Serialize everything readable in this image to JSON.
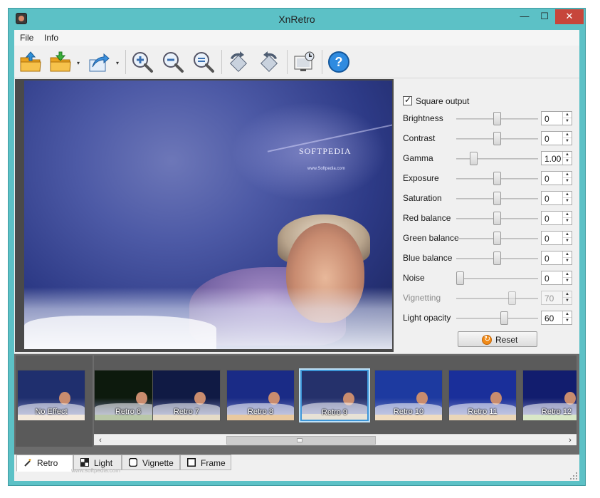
{
  "window": {
    "title": "XnRetro",
    "accent": "#5cc1c6",
    "close_color": "#c7463b",
    "min_symbol": "—",
    "max_symbol": "☐",
    "close_symbol": "✕"
  },
  "menu": {
    "items": [
      {
        "label": "File"
      },
      {
        "label": "Info"
      }
    ]
  },
  "toolbar": {
    "buttons": [
      {
        "icon": "open-folder-icon"
      },
      {
        "icon": "save-folder-icon",
        "dropdown": "▾"
      },
      {
        "icon": "export-share-icon",
        "dropdown": "▾"
      },
      {
        "icon": "zoom-in-icon"
      },
      {
        "icon": "zoom-out-icon"
      },
      {
        "icon": "zoom-fit-icon"
      },
      {
        "icon": "rotate-left-icon"
      },
      {
        "icon": "rotate-right-icon"
      },
      {
        "icon": "set-wallpaper-icon"
      },
      {
        "icon": "help-icon"
      }
    ]
  },
  "preview": {
    "logo_text": "SOFTPEDIA",
    "url_text": "www.Softpedia.com"
  },
  "settings": {
    "square_output": {
      "label": "Square output",
      "checked": true
    },
    "sliders": [
      {
        "label": "Brightness",
        "value": "0",
        "level": 0.5,
        "enabled": true
      },
      {
        "label": "Contrast",
        "value": "0",
        "level": 0.5,
        "enabled": true
      },
      {
        "label": "Gamma",
        "value": "1.00",
        "level": 0.18,
        "enabled": true
      },
      {
        "label": "Exposure",
        "value": "0",
        "level": 0.5,
        "enabled": true
      },
      {
        "label": "Saturation",
        "value": "0",
        "level": 0.5,
        "enabled": true
      },
      {
        "label": "Red balance",
        "value": "0",
        "level": 0.5,
        "enabled": true
      },
      {
        "label": "Green balance",
        "value": "0",
        "level": 0.5,
        "enabled": true
      },
      {
        "label": "Blue balance",
        "value": "0",
        "level": 0.5,
        "enabled": true
      },
      {
        "label": "Noise",
        "value": "0",
        "level": 0.0,
        "enabled": true
      },
      {
        "label": "Vignetting",
        "value": "70",
        "level": 0.7,
        "enabled": false
      },
      {
        "label": "Light opacity",
        "value": "60",
        "level": 0.6,
        "enabled": true
      }
    ],
    "reset_label": "Reset",
    "spin_up": "▲",
    "spin_down": "▼"
  },
  "presets": {
    "items": [
      {
        "label": "No Effect",
        "sky": "#1f2f6e",
        "base": "#f3e9dc",
        "selected": false
      },
      {
        "label": "Retro 6",
        "sky": "#0d1a0d",
        "base": "#b9c7a8",
        "selected": false
      },
      {
        "label": "Retro 7",
        "sky": "#101a44",
        "base": "#e6dcc7",
        "selected": false
      },
      {
        "label": "Retro 8",
        "sky": "#1a2b86",
        "base": "#e9c9a0",
        "selected": false
      },
      {
        "label": "Retro 9",
        "sky": "#25316b",
        "base": "#e7e2d6",
        "selected": true
      },
      {
        "label": "Retro 10",
        "sky": "#1d3aa0",
        "base": "#f0dcc0",
        "selected": false
      },
      {
        "label": "Retro 11",
        "sky": "#1a2f9a",
        "base": "#ead6b8",
        "selected": false
      },
      {
        "label": "Retro 12",
        "sky": "#121d6e",
        "base": "#d9e8c7",
        "selected": false
      }
    ],
    "scroll_left": "‹",
    "scroll_right": "›"
  },
  "tabs": [
    {
      "label": "Retro",
      "icon": "magic-wand-icon",
      "active": true
    },
    {
      "label": "Light",
      "icon": "light-grid-icon",
      "active": false
    },
    {
      "label": "Vignette",
      "icon": "vignette-icon",
      "active": false
    },
    {
      "label": "Frame",
      "icon": "frame-icon",
      "active": false
    }
  ],
  "watermark": "www.softpedia.com"
}
